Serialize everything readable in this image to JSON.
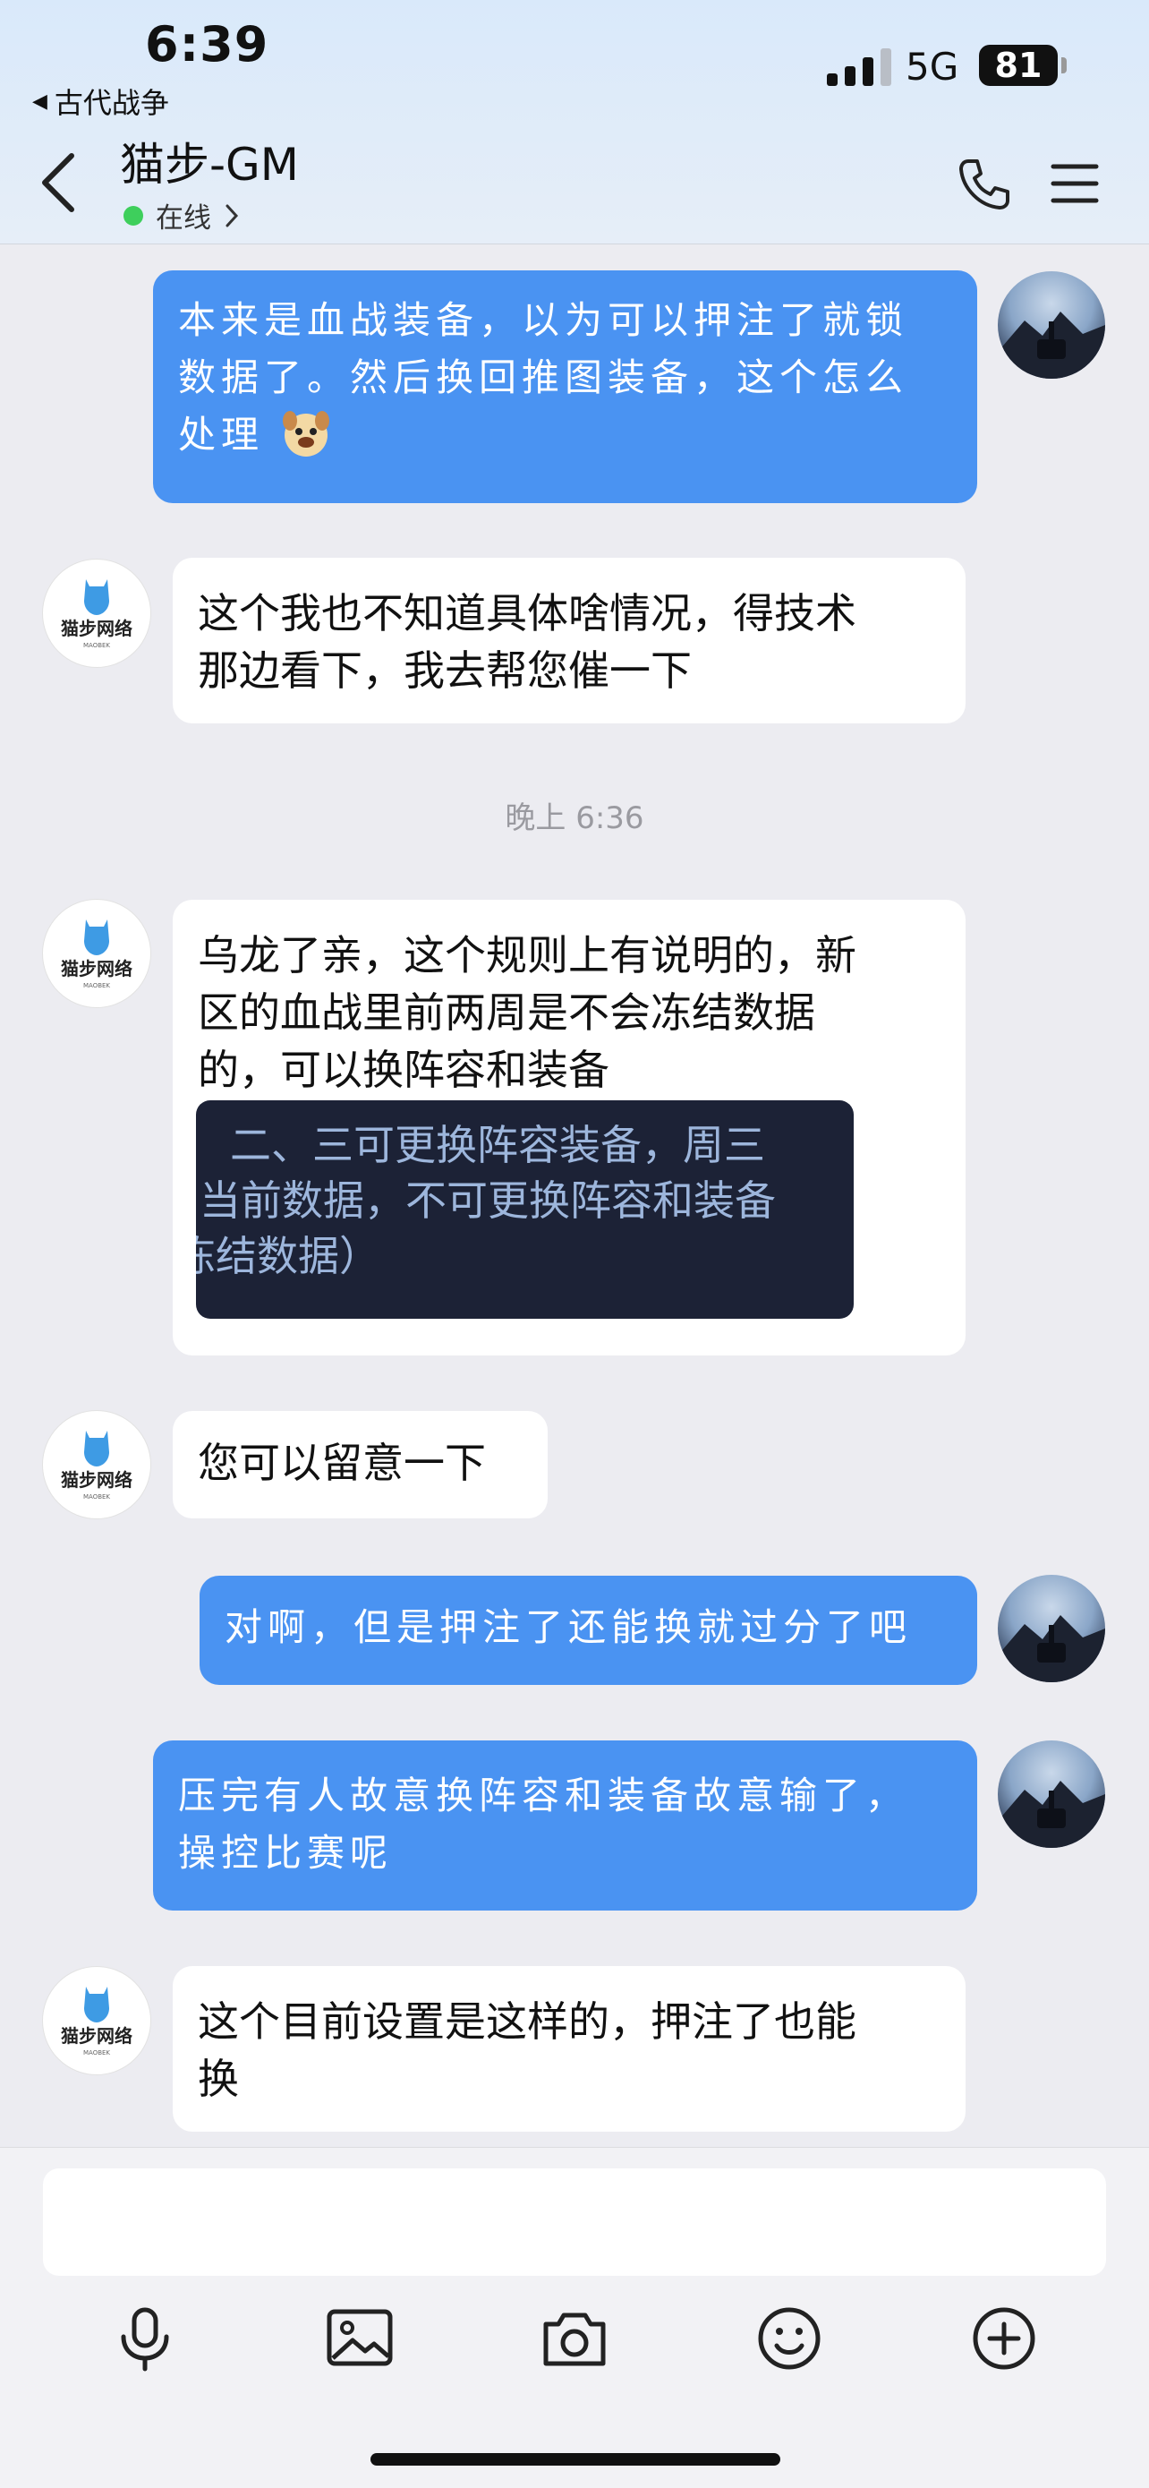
{
  "status_bar": {
    "time": "6:39",
    "back_app": "古代战争",
    "network": "5G",
    "battery": "81"
  },
  "header": {
    "title": "猫步-GM",
    "status": "在线"
  },
  "messages": [
    {
      "text_line1": "本来是血战装备，以为可以押注了就锁",
      "text_line2": "数据了。然后换回推图装备，这个怎么",
      "text_line3": "处理"
    },
    {
      "text_line1": "这个我也不知道具体啥情况，得技术",
      "text_line2": "那边看下，我去帮您催一下"
    },
    {
      "text_line1": "乌龙了亲，这个规则上有说明的，新",
      "text_line2": "区的血战里前两周是不会冻结数据",
      "text_line3": "的，可以换阵容和装备"
    },
    {
      "text": "您可以留意一下"
    },
    {
      "text": "对啊，但是押注了还能换就过分了吧"
    },
    {
      "text_line1": "压完有人故意换阵容和装备故意输了，",
      "text_line2": "操控比赛呢"
    },
    {
      "text_line1": "这个目前设置是这样的，押注了也能",
      "text_line2": "换"
    }
  ],
  "timestamp": "晚上 6:36",
  "screenshot_image": {
    "line1": "二、三可更换阵容装备，周三",
    "line2": "当前数据，不可更换阵容和装备",
    "line3": "冻结数据）"
  },
  "gm_avatar": {
    "logo_text": "猫步网络",
    "logo_sub": "MAOBEK"
  },
  "colors": {
    "outgoing_bubble": "#4a93f2",
    "incoming_bubble": "#ffffff",
    "online": "#3ecf5c"
  },
  "icons": [
    "chevron-left-icon",
    "phone-icon",
    "menu-icon",
    "microphone-icon",
    "image-icon",
    "camera-icon",
    "emoji-icon",
    "plus-icon"
  ]
}
